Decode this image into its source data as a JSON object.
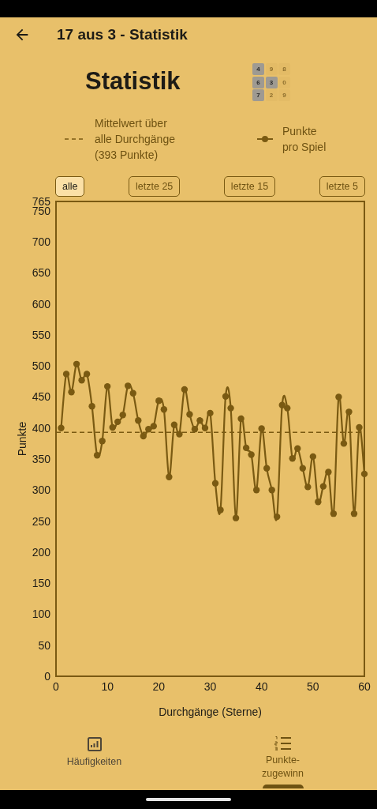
{
  "app_bar": {
    "title": "17 aus 3 - Statistik"
  },
  "heading": "Statistik",
  "digit_grid": [
    [
      {
        "digit": "4",
        "selected": true
      },
      {
        "digit": "9",
        "selected": false
      },
      {
        "digit": "8",
        "selected": false
      }
    ],
    [
      {
        "digit": "6",
        "selected": true
      },
      {
        "digit": "3",
        "selected": true
      },
      {
        "digit": "0",
        "selected": false
      }
    ],
    [
      {
        "digit": "7",
        "selected": true
      },
      {
        "digit": "2",
        "selected": false
      },
      {
        "digit": "9",
        "selected": false
      }
    ]
  ],
  "legend": [
    {
      "kind": "dashed",
      "label": "Mittelwert über\nalle Durchgänge\n(393 Punkte)"
    },
    {
      "kind": "line-dot"
    }
  ],
  "filters": [
    {
      "label": "alle",
      "selected": true
    },
    {
      "label": "letzte 25",
      "selected": false
    },
    {
      "label": "letzte 15",
      "selected": false
    },
    {
      "label": "letzte 5",
      "selected": false
    }
  ],
  "chart_data": {
    "type": "line",
    "xlabel": "Durchgänge (Sterne)",
    "ylabel": "Punkte",
    "xlim": [
      0,
      60
    ],
    "ylim": [
      0,
      765
    ],
    "xticks": [
      0,
      10,
      20,
      30,
      40,
      50,
      60
    ],
    "yticks": [
      0,
      50,
      100,
      150,
      200,
      250,
      300,
      350,
      400,
      450,
      500,
      550,
      600,
      650,
      700,
      750,
      765
    ],
    "x": [
      1,
      2,
      3,
      4,
      5,
      6,
      7,
      8,
      9,
      10,
      11,
      12,
      13,
      14,
      15,
      16,
      17,
      18,
      19,
      20,
      21,
      22,
      23,
      24,
      25,
      26,
      27,
      28,
      29,
      30,
      31,
      32,
      33,
      34,
      35,
      36,
      37,
      38,
      39,
      40,
      41,
      42,
      43,
      44,
      45,
      46,
      47,
      48,
      49,
      50,
      51,
      52,
      53,
      54,
      55,
      56,
      57,
      58,
      59,
      60
    ],
    "series": [
      {
        "name": "Punkte pro Spiel",
        "color": "#7a5a12",
        "marker": "circle",
        "values": [
          400,
          487,
          458,
          503,
          477,
          487,
          435,
          356,
          379,
          467,
          401,
          410,
          421,
          468,
          456,
          412,
          387,
          398,
          403,
          444,
          430,
          321,
          405,
          390,
          462,
          422,
          398,
          412,
          400,
          424,
          311,
          268,
          451,
          432,
          255,
          415,
          368,
          357,
          300,
          399,
          335,
          300,
          257,
          437,
          432,
          351,
          367,
          335,
          305,
          354,
          281,
          306,
          329,
          262,
          450,
          375,
          426,
          262,
          401,
          326
        ]
      }
    ],
    "ref_lines": [
      {
        "axis": "y",
        "value": 393
      }
    ]
  },
  "bottom_nav": [
    {
      "kind": "bar-chart",
      "label": "Häufigkeiten",
      "selected": false
    },
    {
      "kind": "numbered-list",
      "label": "Punkte-\nzugewinn",
      "selected": true
    }
  ]
}
